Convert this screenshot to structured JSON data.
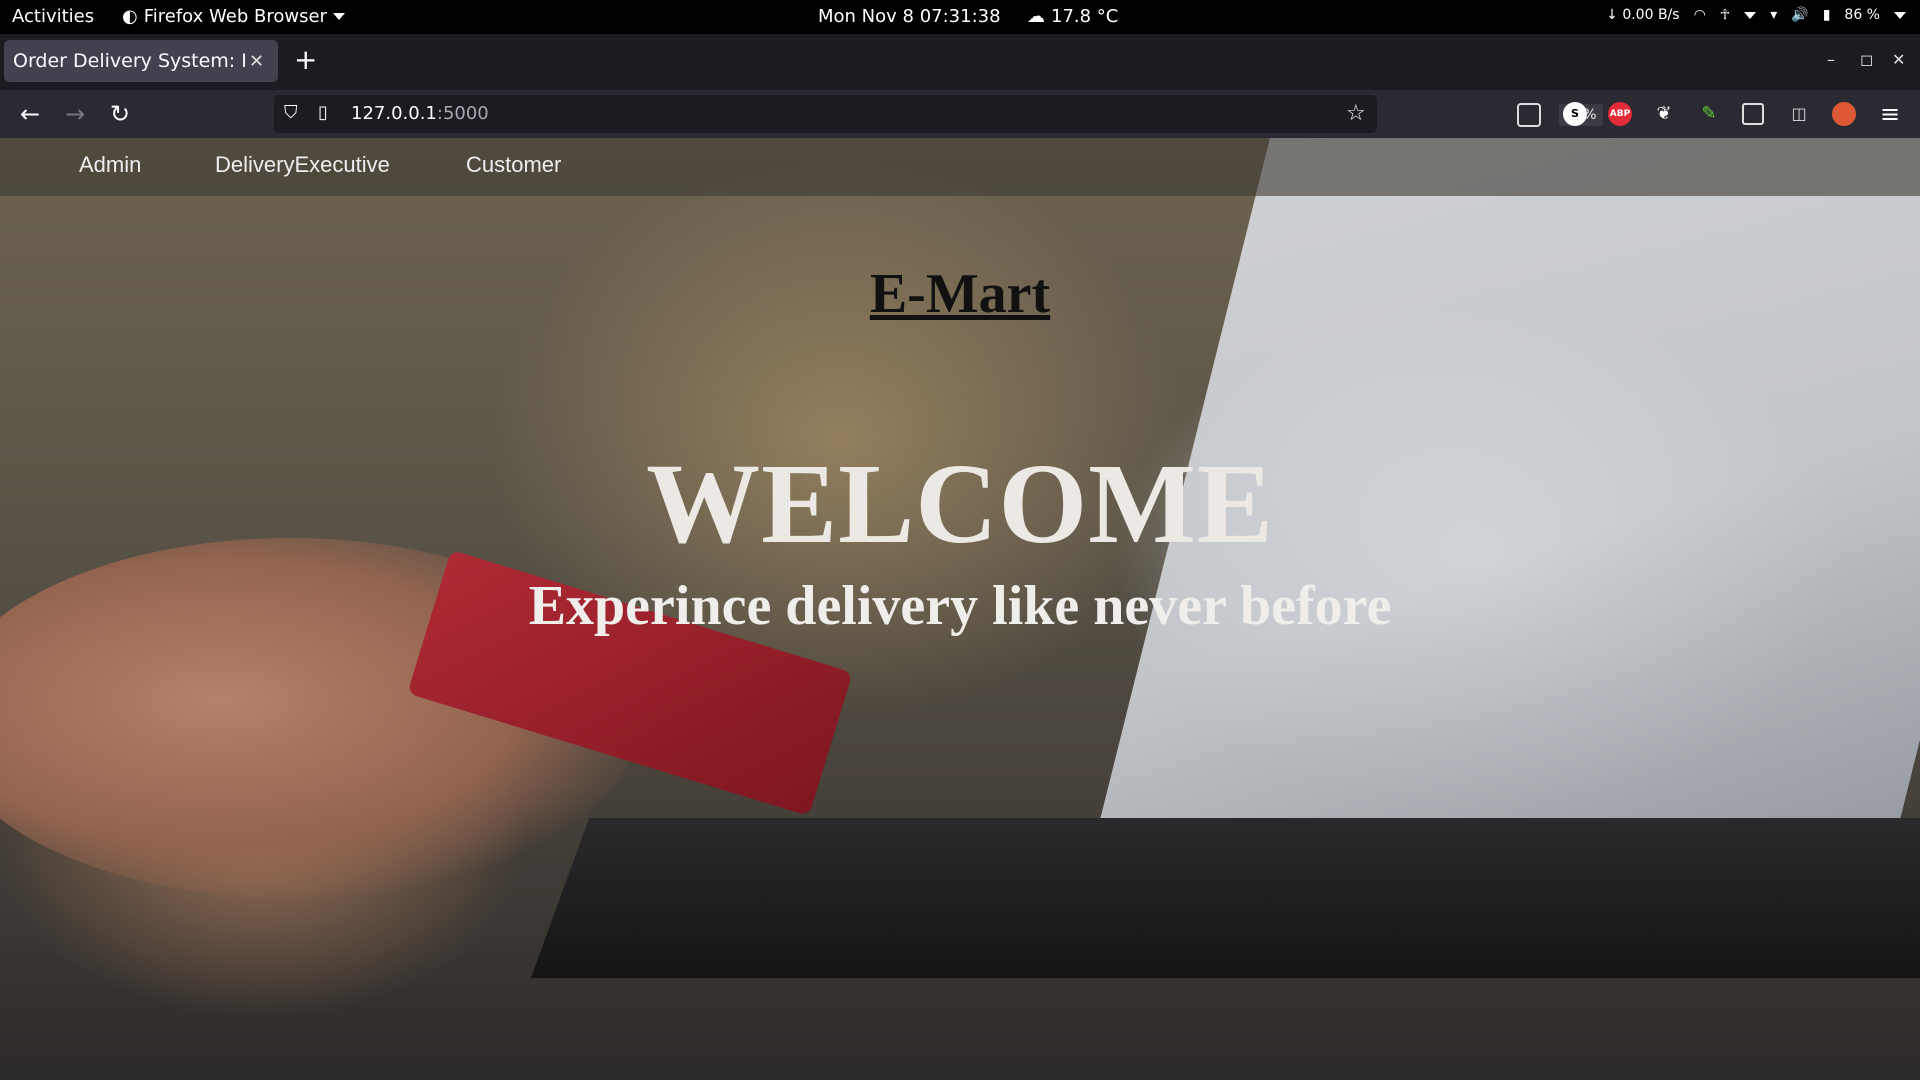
{
  "system_bar": {
    "activities": "Activities",
    "app_name": "Firefox Web Browser",
    "clock": "Mon Nov 8  07:31:38",
    "weather": "17.8 °C",
    "net_speed": "↓ 0.00 B/s",
    "battery": "86 %"
  },
  "browser": {
    "tab_title": "Order Delivery System: Home",
    "url_host": "127.0.0.1",
    "url_port": ":5000",
    "zoom": "90%",
    "extensions": [
      "S",
      "ABP"
    ]
  },
  "site": {
    "nav": [
      "Admin",
      "DeliveryExecutive",
      "Customer"
    ],
    "brand": "E-Mart",
    "welcome": "WELCOME",
    "tagline": "Experince delivery like never before"
  },
  "colors": {
    "topbar": "#000000",
    "tabstrip": "#1c1b22",
    "navbar": "#2b2a33",
    "abp_red": "#e22c37"
  }
}
